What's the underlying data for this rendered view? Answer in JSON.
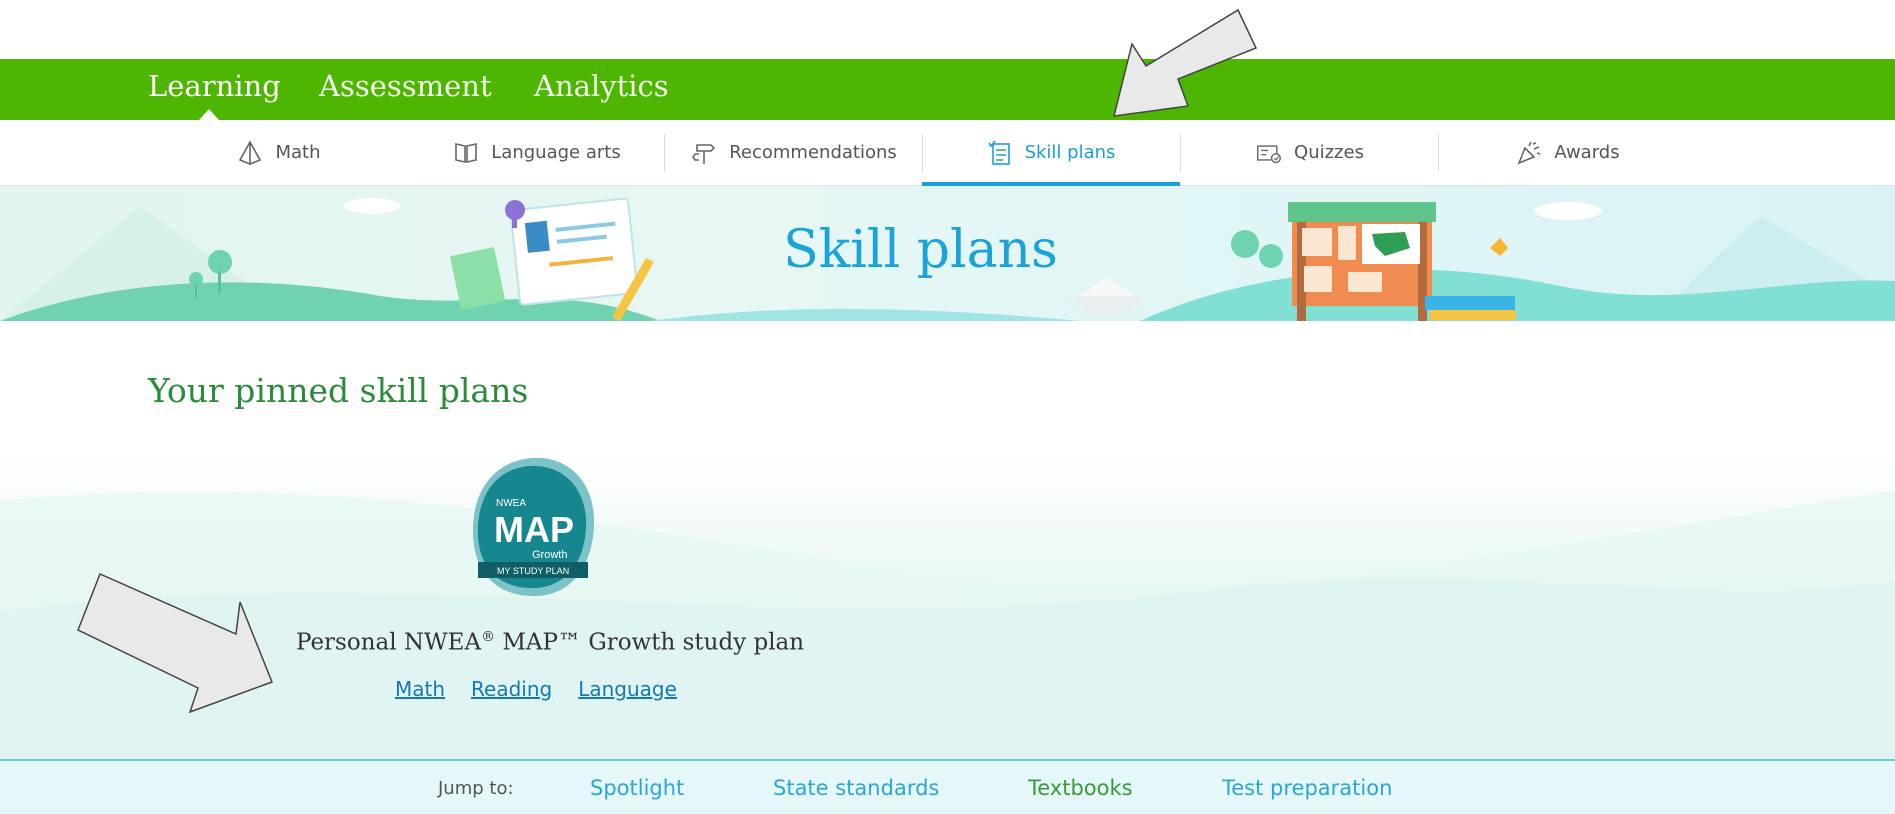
{
  "primary_nav": {
    "tabs": [
      {
        "label": "Learning",
        "active": true
      },
      {
        "label": "Assessment",
        "active": false
      },
      {
        "label": "Analytics",
        "active": false
      }
    ]
  },
  "secondary_nav": {
    "items": [
      {
        "label": "Math",
        "icon": "pyramid-icon",
        "active": false
      },
      {
        "label": "Language arts",
        "icon": "open-book-icon",
        "active": false
      },
      {
        "label": "Recommendations",
        "icon": "signpost-icon",
        "active": false
      },
      {
        "label": "Skill plans",
        "icon": "checklist-icon",
        "active": true
      },
      {
        "label": "Quizzes",
        "icon": "quiz-icon",
        "active": false
      },
      {
        "label": "Awards",
        "icon": "party-popper-icon",
        "active": false
      }
    ]
  },
  "banner": {
    "title": "Skill plans"
  },
  "pinned": {
    "heading": "Your pinned skill plans",
    "badge": {
      "org": "NWEA",
      "name": "MAP",
      "sub": "Growth",
      "caption": "MY STUDY PLAN"
    },
    "plan": {
      "name_prefix": "Personal NWEA",
      "registered": "®",
      "name_suffix": " MAP™ Growth study plan",
      "links": [
        "Math",
        "Reading",
        "Language"
      ]
    }
  },
  "jump_bar": {
    "label": "Jump to:",
    "links": [
      {
        "label": "Spotlight",
        "color": "#2ba7d5"
      },
      {
        "label": "State standards",
        "color": "#2ba7d5"
      },
      {
        "label": "Textbooks",
        "color": "#3a9a3a"
      },
      {
        "label": "Test preparation",
        "color": "#2ba7d5"
      }
    ]
  },
  "colors": {
    "brand_green": "#4eb600",
    "accent_blue": "#1aa0d8",
    "heading_green": "#2a8b3a"
  }
}
